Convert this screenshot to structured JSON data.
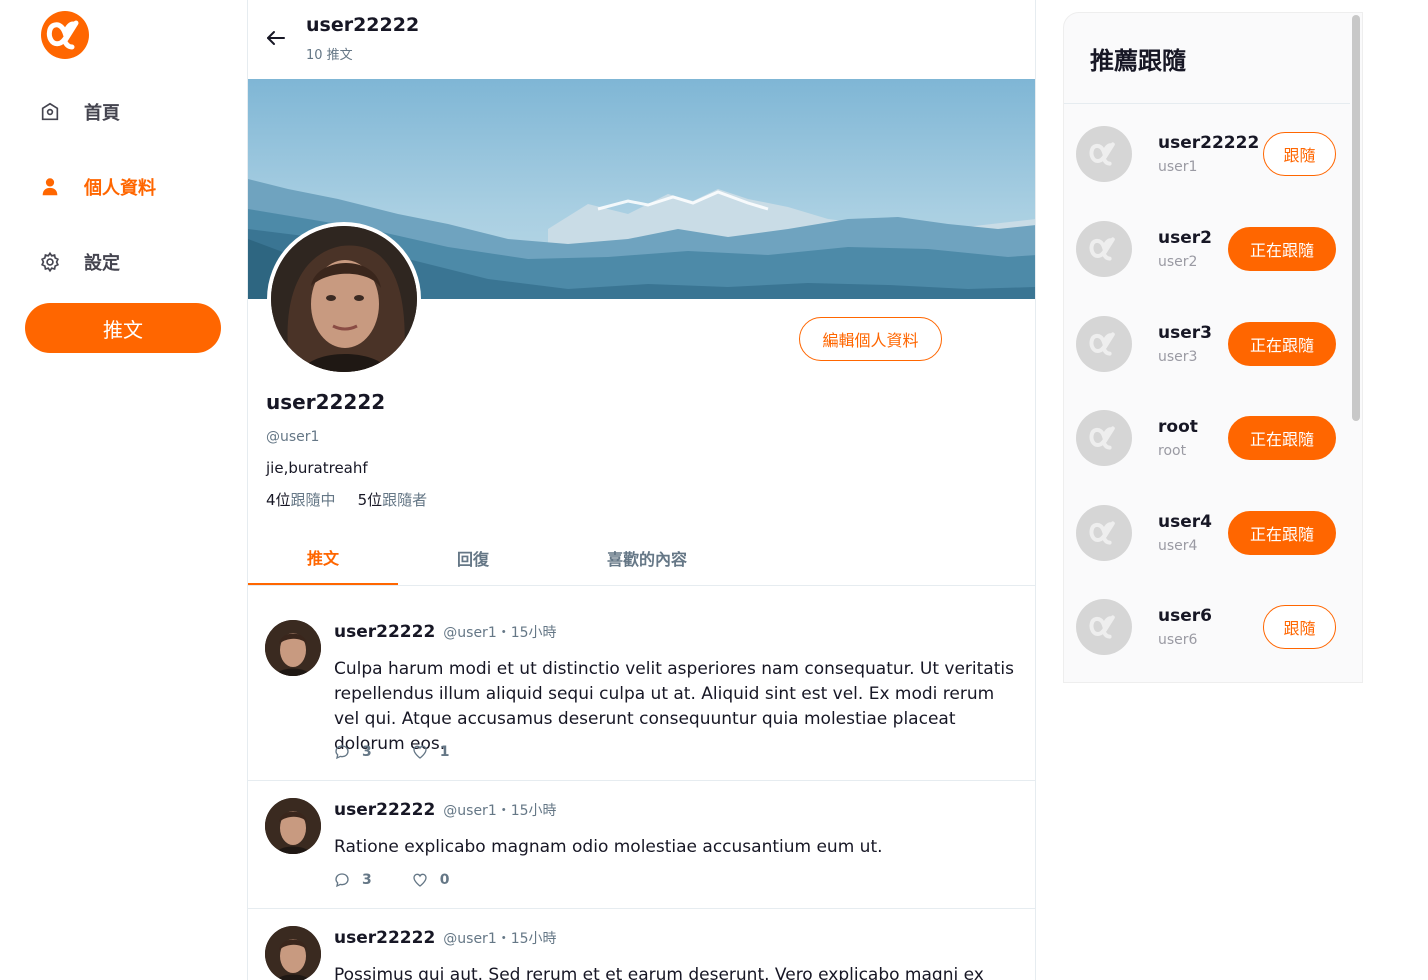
{
  "sidebar": {
    "items": [
      {
        "label": "首頁",
        "icon": "home-icon"
      },
      {
        "label": "個人資料",
        "icon": "user-icon"
      },
      {
        "label": "設定",
        "icon": "gear-icon"
      }
    ],
    "tweet_button": "推文"
  },
  "topbar": {
    "title": "user22222",
    "subtitle": "10 推文"
  },
  "profile": {
    "name": "user22222",
    "handle": "@user1",
    "bio": "jie,buratreahf",
    "following_count": "4位",
    "following_label": "跟隨中",
    "followers_count": "5位",
    "followers_label": "跟隨者",
    "edit_button": "編輯個人資料"
  },
  "tabs": [
    {
      "label": "推文"
    },
    {
      "label": "回復"
    },
    {
      "label": "喜歡的內容"
    }
  ],
  "tweets": [
    {
      "name": "user22222",
      "meta": "@user1・15小時",
      "text": "Culpa harum modi et ut distinctio velit asperiores nam consequatur. Ut veritatis repellendus illum aliquid sequi culpa ut at. Aliquid sint est vel. Ex modi rerum vel qui. Atque accusamus deserunt consequuntur quia molestiae placeat dolorum eos.",
      "replies": "3",
      "likes": "1"
    },
    {
      "name": "user22222",
      "meta": "@user1・15小時",
      "text": "Ratione explicabo magnam odio molestiae accusantium eum ut.",
      "replies": "3",
      "likes": "0"
    },
    {
      "name": "user22222",
      "meta": "@user1・15小時",
      "text": "Possimus qui aut. Sed rerum et et earum deserunt. Vero explicabo magni ex",
      "replies": "",
      "likes": ""
    }
  ],
  "recommend": {
    "title": "推薦跟隨",
    "users": [
      {
        "name": "user22222",
        "handle": "user1",
        "button": "跟隨"
      },
      {
        "name": "user2",
        "handle": "user2",
        "button": "正在跟隨"
      },
      {
        "name": "user3",
        "handle": "user3",
        "button": "正在跟隨"
      },
      {
        "name": "root",
        "handle": "root",
        "button": "正在跟隨"
      },
      {
        "name": "user4",
        "handle": "user4",
        "button": "正在跟隨"
      },
      {
        "name": "user6",
        "handle": "user6",
        "button": "跟隨"
      }
    ]
  },
  "colors": {
    "accent": "#ff6600",
    "text": "#171725",
    "muted": "#657786",
    "panel": "#fafafb"
  }
}
